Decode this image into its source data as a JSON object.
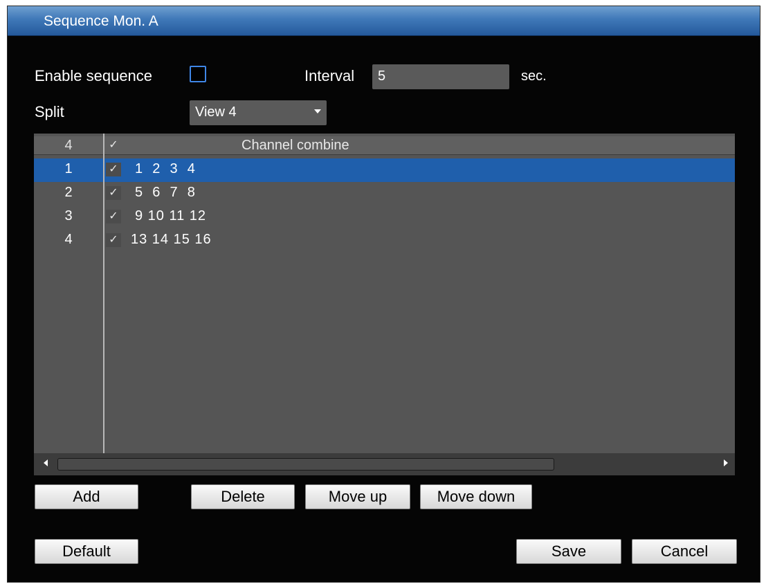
{
  "window": {
    "title": "Sequence Mon. A"
  },
  "settings": {
    "enable_label": "Enable sequence",
    "enable_checked": false,
    "interval_label": "Interval",
    "interval_value": "5",
    "interval_unit": "sec.",
    "split_label": "Split",
    "split_value": "View 4"
  },
  "table": {
    "header": {
      "index": "4",
      "check": "✓",
      "channels": "Channel combine"
    },
    "rows": [
      {
        "index": "1",
        "check": "✓",
        "channels": "1  2  3  4",
        "selected": true
      },
      {
        "index": "2",
        "check": "✓",
        "channels": "5  6  7  8",
        "selected": false
      },
      {
        "index": "3",
        "check": "✓",
        "channels": "9 10 11 12",
        "selected": false
      },
      {
        "index": "4",
        "check": "✓",
        "channels": "13 14 15 16",
        "selected": false
      }
    ]
  },
  "buttons": {
    "add": "Add",
    "delete": "Delete",
    "move_up": "Move up",
    "move_down": "Move down",
    "default": "Default",
    "save": "Save",
    "cancel": "Cancel"
  },
  "colors": {
    "title_bar": "#3f78b8",
    "selected_row": "#1f5fac",
    "checkbox_border": "#3f86e6"
  }
}
